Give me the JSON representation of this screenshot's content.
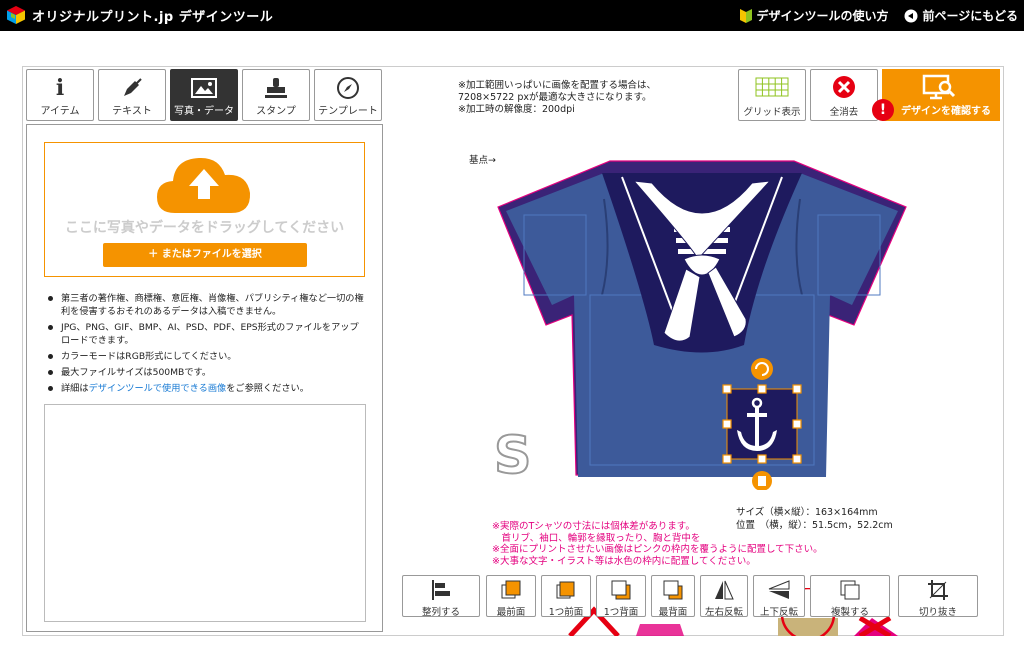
{
  "header": {
    "logo": "オリジナルプリント.jp デザインツール",
    "howto": "デザインツールの使い方",
    "back": "前ページにもどる"
  },
  "tabs": [
    {
      "label": "アイテム",
      "icon": "info-icon"
    },
    {
      "label": "テキスト",
      "icon": "pen-icon"
    },
    {
      "label": "写真・データ",
      "icon": "image-icon",
      "active": true
    },
    {
      "label": "スタンプ",
      "icon": "stamp-icon"
    },
    {
      "label": "テンプレート",
      "icon": "compass-icon"
    }
  ],
  "upload": {
    "drop_text": "ここに写真やデータをドラッグしてください",
    "file_button": "またはファイルを選択"
  },
  "notes": [
    "第三者の著作権、商標権、意匠権、肖像権、パブリシティ権など一切の権利を侵害するおそれのあるデータは入稿できません。",
    "JPG、PNG、GIF、BMP、AI、PSD、PDF、EPS形式のファイルをアップロードできます。",
    "カラーモードはRGB形式にしてください。",
    "最大ファイルサイズは500MBです。"
  ],
  "note_detail": {
    "pre": "詳細は",
    "link": "デザインツールで使用できる画像",
    "post": "をご参照ください。"
  },
  "canvas_info": {
    "line1": "※加工範囲いっぱいに画像を配置する場合は、",
    "line2": "7208×5722 pxが最適な大きさになります。",
    "line3": "※加工時の解像度：200dpi"
  },
  "tools": {
    "grid": "グリッド表示",
    "clear": "全消去",
    "confirm": "デザインを確認する"
  },
  "origin_label": "基点→",
  "size_letter": "S",
  "selection": {
    "size_label": "サイズ（横×縦）",
    "size_value": "：163×164mm",
    "pos_label": "位置　（横，縦）",
    "pos_value": "：51.5cm，52.2cm"
  },
  "warnings": [
    "※実際のTシャツの寸法には個体差があります。",
    "　首リブ、袖口、輪郭を縁取ったり、胸と背中を",
    "※全面にプリントさせたい画像はピンクの枠内を覆うように配置して下さい。",
    "※大事な文字・イラスト等は水色の枠内に配置してください。"
  ],
  "bottom_tools": [
    {
      "label": "整列する"
    },
    {
      "label": "最前面"
    },
    {
      "label": "1つ前面"
    },
    {
      "label": "1つ背面"
    },
    {
      "label": "最背面"
    },
    {
      "label": "左右反転"
    },
    {
      "label": "上下反転"
    },
    {
      "label": "複製する"
    },
    {
      "label": "切り抜き"
    }
  ],
  "colors": {
    "accent": "#f59300",
    "shirt": "#3d5a9a",
    "collar": "#1e1a5e",
    "pink": "#e4007f"
  }
}
